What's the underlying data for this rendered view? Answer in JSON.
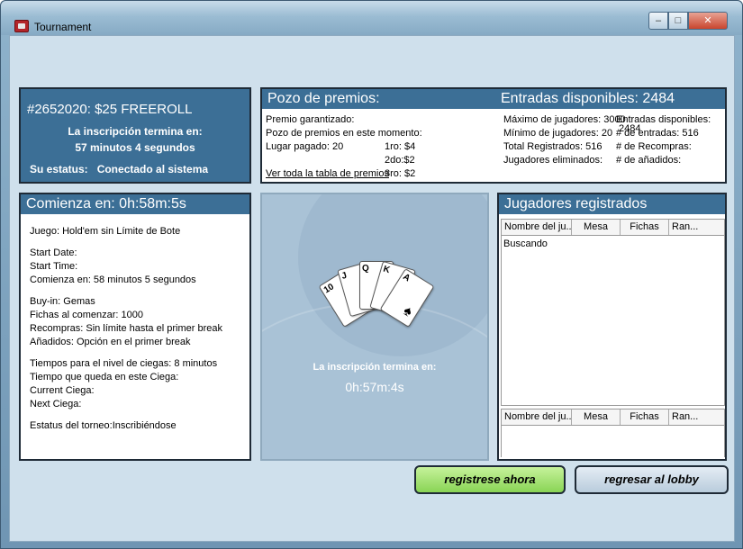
{
  "window": {
    "title": "Tournament",
    "ghost_title": "",
    "controls": {
      "minimize": "–",
      "maximize": "□",
      "close": "✕"
    },
    "icon": "app-card-icon"
  },
  "freeroll": {
    "title": "#2652020: $25 FREEROLL",
    "closing_label": "La inscripción termina en:",
    "closing_value": "57 minutos 4 segundos",
    "status_label": "Su estatus:",
    "status_value": "Conectado al sistema"
  },
  "prize": {
    "title": "Pozo de premios:",
    "entries_available_header": "Entradas disponibles: 2484",
    "guaranteed_label": "Premio garantizado:",
    "current_pool_label": "Pozo de premios en este momento:",
    "places_paid": "Lugar pagado: 20",
    "place_1": "1ro: $4",
    "place_2": "2do:$2",
    "place_3": "3ro: $2",
    "full_table_link": "Ver toda la tabla de premios",
    "max_players": "Máximo de jugadores: 3000",
    "min_players": "Mínimo de jugadores: 20",
    "total_registered": "Total Registrados: 516",
    "players_eliminated": "Jugadores eliminados:",
    "entries_available_label": "Entradas disponibles:",
    "entries_available_value": "2484",
    "entries": "# de entradas: 516",
    "rebuys": "# de Recompras:",
    "addons": "# de añadidos:"
  },
  "start": {
    "title": "Comienza en: 0h:58m:5s",
    "game": "Juego: Hold'em sin Límite de Bote",
    "start_date": "Start Date:",
    "start_time": "Start Time:",
    "starts_in": "Comienza en: 58 minutos 5 segundos",
    "buy_in": "Buy-in: Gemas",
    "starting_chips": "Fichas al comenzar: 1000",
    "rebuys": "Recompras: Sin límite hasta el primer break",
    "addons": "Añadidos: Opción en el primer break",
    "blind_level_time": "Tiempos para el nivel de ciegas: 8 minutos",
    "time_left_blind": "Tiempo que queda en este Ciega:",
    "current_blind": "Current Ciega:",
    "next_blind": "Next Ciega:",
    "tournament_status": "Estatus del torneo:Inscribiéndose"
  },
  "center": {
    "registration_label": "La inscripción termina en:",
    "registration_time": "0h:57m:4s",
    "cards": [
      "10",
      "J",
      "Q",
      "K",
      "A"
    ],
    "suit": "♠"
  },
  "players": {
    "title": "Jugadores registrados",
    "columns": [
      "Nombre del ju...",
      "Mesa",
      "Fichas",
      "Ran..."
    ],
    "searching": "Buscando",
    "columns2": [
      "Nombre del ju...",
      "Mesa",
      "Fichas",
      "Ran..."
    ]
  },
  "buttons": {
    "register": "registrese ahora",
    "lobby": "regresar al lobby"
  },
  "colors": {
    "panel_header": "#3c6f96",
    "register_button": "#89d455",
    "lobby_button": "#b9ccdc",
    "client_bg": "#cfe0ec"
  }
}
